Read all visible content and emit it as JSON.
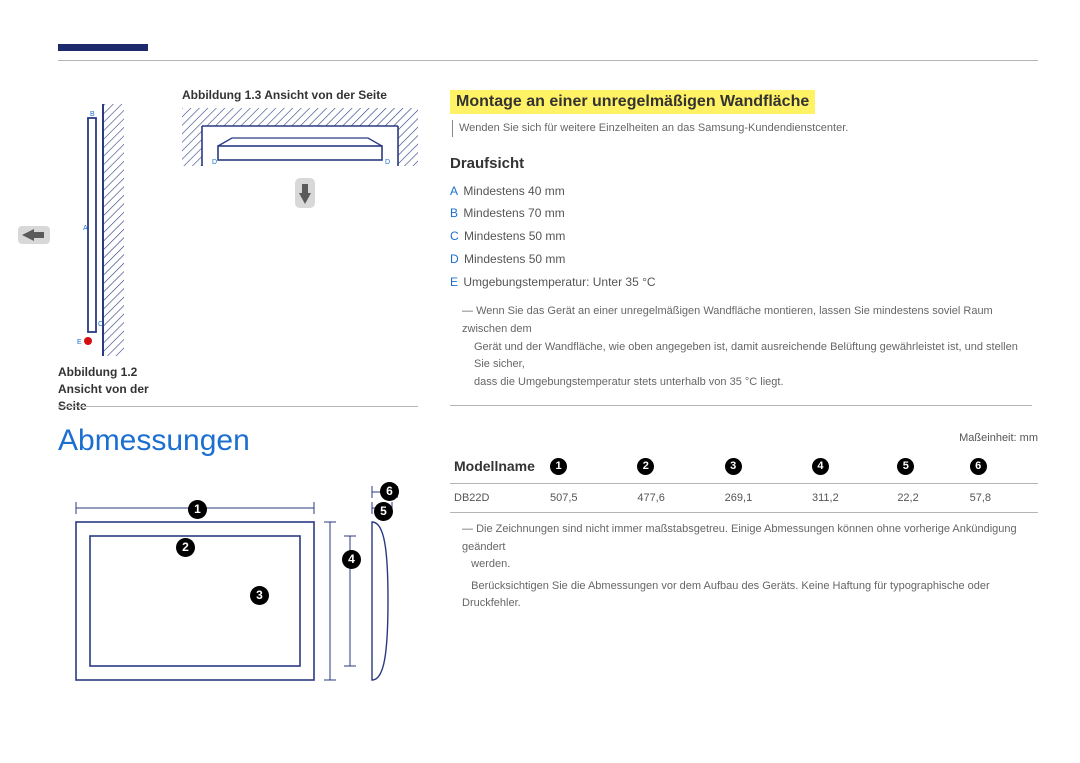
{
  "header": {},
  "figures": {
    "fig13_label": "Abbildung 1.3 Ansicht von der Seite",
    "fig12_label": "Abbildung 1.2 Ansicht von der Seite",
    "side_labels": {
      "B": "B",
      "A": "A",
      "C": "C",
      "E": "E"
    },
    "top_labels": {
      "D_left": "D",
      "D_right": "D"
    }
  },
  "mounting": {
    "title": "Montage an einer unregelmäßigen Wandfläche",
    "note": "Wenden Sie sich für weitere Einzelheiten an das Samsung-Kundendienstcenter.",
    "subheading": "Draufsicht",
    "specs": [
      {
        "key": "A",
        "value": "Mindestens 40 mm"
      },
      {
        "key": "B",
        "value": "Mindestens 70 mm"
      },
      {
        "key": "C",
        "value": "Mindestens 50 mm"
      },
      {
        "key": "D",
        "value": "Mindestens 50 mm"
      },
      {
        "key": "E",
        "value": "Umgebungstemperatur: Unter 35 °C"
      }
    ],
    "long_note_lead": "Wenn Sie das Gerät an einer unregelmäßigen Wandfläche montieren, lassen Sie mindestens soviel Raum zwischen dem",
    "long_note_l2": "Gerät und der Wandfläche, wie oben angegeben ist, damit ausreichende Belüftung gewährleistet ist, und stellen Sie sicher,",
    "long_note_l3": "dass die Umgebungstemperatur stets unterhalb von 35 °C liegt."
  },
  "dimensions": {
    "section_title": "Abmessungen",
    "unit_label": "Maßeinheit: mm",
    "header_model": "Modellname",
    "columns": [
      "1",
      "2",
      "3",
      "4",
      "5",
      "6"
    ],
    "row": {
      "model": "DB22D",
      "values": [
        "507,5",
        "477,6",
        "269,1",
        "311,2",
        "22,2",
        "57,8"
      ]
    },
    "footnote1_a": "Die Zeichnungen sind nicht immer maßstabsgetreu. Einige Abmessungen können ohne vorherige Ankündigung geändert",
    "footnote1_b": "werden.",
    "footnote2": "Berücksichtigen Sie die Abmessungen vor dem Aufbau des Geräts. Keine Haftung für typographische oder Druckfehler."
  }
}
